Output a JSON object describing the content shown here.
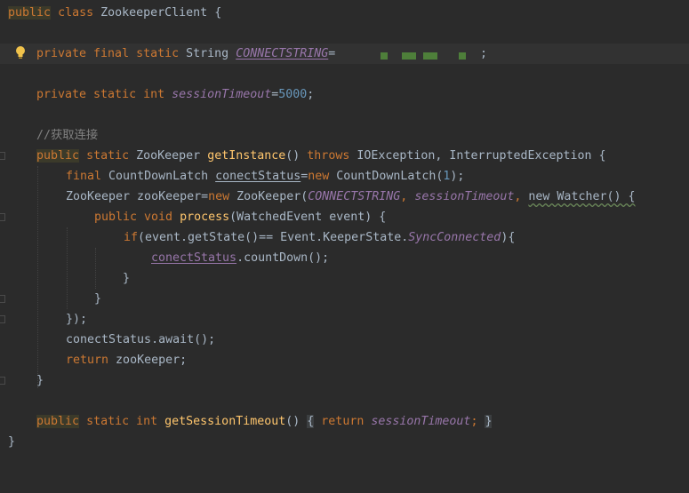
{
  "editor": {
    "colors": {
      "background": "#2b2b2b",
      "keyword": "#cc7832",
      "field": "#9876aa",
      "number": "#6897bb",
      "comment": "#808080",
      "method": "#ffc66d",
      "text": "#a9b7c6"
    },
    "lines": {
      "l1_kw": "public",
      "l1_kw2": "class",
      "l1_name": "ZookeeperClient {",
      "l3_kw": "private final static",
      "l3_type": "String",
      "l3_field": "CONNECTSTRING",
      "l3_eq": "=",
      "l3_end": ";",
      "l5_kw": "private static",
      "l5_type": "int",
      "l5_field": "sessionTimeout",
      "l5_eq": "=",
      "l5_num": "5000",
      "l5_end": ";",
      "l7_comment": "//获取连接",
      "l8_kw": "public",
      "l8_kw2": "static",
      "l8_type": "ZooKeeper",
      "l8_method": "getInstance",
      "l8_paren": "()",
      "l8_throws": "throws",
      "l8_ex": "IOException, InterruptedException {",
      "l9_kw": "final",
      "l9_type": "CountDownLatch",
      "l9_var": "conectStatus",
      "l9_eq": "=",
      "l9_new": "new",
      "l9_ctor": "CountDownLatch(",
      "l9_num": "1",
      "l9_end": ");",
      "l10_type": "ZooKeeper zooKeeper=",
      "l10_new": "new",
      "l10_ctor": "ZooKeeper(",
      "l10_f1": "CONNECTSTRING",
      "l10_c1": ", ",
      "l10_f2": "sessionTimeout",
      "l10_c2": ", ",
      "l10_watcher": "new Watcher() {",
      "l11_kw": "public void",
      "l11_method": "process",
      "l11_args": "(WatchedEvent event) {",
      "l12_kw": "if",
      "l12_a": "(event.getState()== Event.KeeperState.",
      "l12_f": "SyncConnected",
      "l12_b": "){",
      "l13_var": "conectStatus",
      "l13_rest": ".countDown();",
      "l14": "}",
      "l15": "}",
      "l16": "});",
      "l17": "conectStatus.await();",
      "l18_kw": "return",
      "l18_rest": " zooKeeper;",
      "l19": "}",
      "l21_kw": "public",
      "l21_kw2": "static int",
      "l21_method": "getSessionTimeout",
      "l21_paren": "()",
      "l21_ob": "{",
      "l21_ret": "return",
      "l21_field": "sessionTimeout",
      "l21_semi": ";",
      "l21_cb": "}",
      "l22": "}"
    }
  },
  "icons": {
    "bulb": "lightbulb-icon",
    "fold": "fold-marker-icon"
  }
}
